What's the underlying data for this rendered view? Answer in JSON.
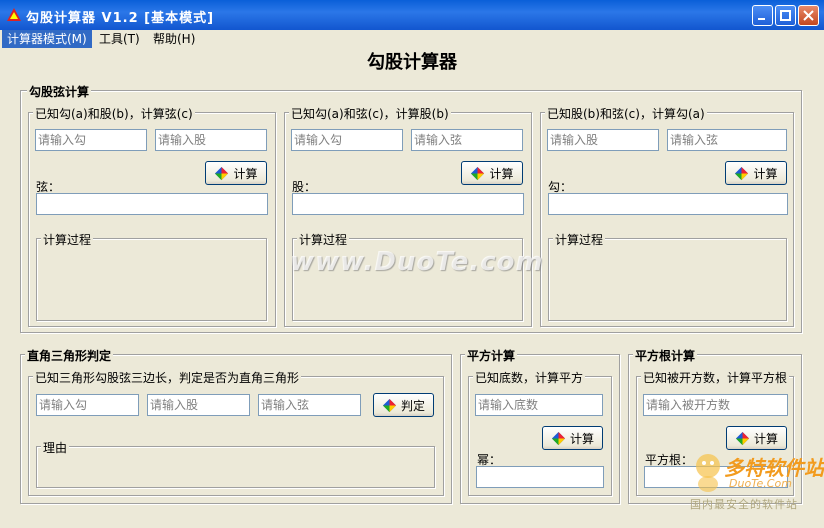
{
  "window": {
    "title": "勾股计算器 V1.2 [基本模式]",
    "controls": [
      "minimize-icon",
      "maximize-icon",
      "close-icon"
    ]
  },
  "menu": [
    {
      "label": "计算器模式(M)"
    },
    {
      "label": "工具(T)"
    },
    {
      "label": "帮助(H)"
    }
  ],
  "heading": "勾股计算器",
  "pythagoras": {
    "title": "勾股弦计算",
    "panels": [
      {
        "legend": "已知勾(a)和股(b)，计算弦(c)",
        "input1": "请输入勾",
        "input2": "请输入股",
        "button": "计算",
        "result_label": "弦：",
        "process": "计算过程"
      },
      {
        "legend": "已知勾(a)和弦(c)，计算股(b)",
        "input1": "请输入勾",
        "input2": "请输入弦",
        "button": "计算",
        "result_label": "股：",
        "process": "计算过程"
      },
      {
        "legend": "已知股(b)和弦(c)，计算勾(a)",
        "input1": "请输入股",
        "input2": "请输入弦",
        "button": "计算",
        "result_label": "勾：",
        "process": "计算过程"
      }
    ]
  },
  "right_triangle": {
    "title": "直角三角形判定",
    "legend": "已知三角形勾股弦三边长，判定是否为直角三角形",
    "input1": "请输入勾",
    "input2": "请输入股",
    "input3": "请输入弦",
    "button": "判定",
    "reason": "理由"
  },
  "square": {
    "title": "平方计算",
    "legend": "已知底数，计算平方",
    "input": "请输入底数",
    "button": "计算",
    "result_label": "幂："
  },
  "sqrt": {
    "title": "平方根计算",
    "legend": "已知被开方数，计算平方根",
    "input": "请输入被开方数",
    "button": "计算",
    "result_label": "平方根："
  },
  "watermark": {
    "site": "www.DuoTe.com",
    "logo_text": "多特软件站",
    "logo_sub": "DuoTe.Com",
    "logo_foot": "国内最安全的软件站"
  }
}
